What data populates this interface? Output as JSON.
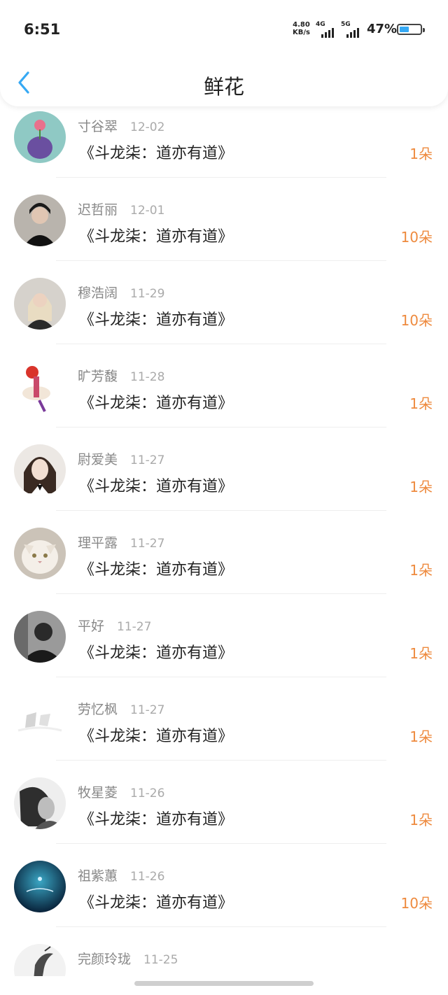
{
  "status": {
    "time": "6:51",
    "net_speed_value": "4.80",
    "net_speed_unit": "KB/s",
    "sig1_label": "4G",
    "sig2_label": "5G",
    "battery_percent": "47%",
    "battery_level": 0.47
  },
  "header": {
    "title": "鲜花",
    "back_icon": "chevron-left-icon"
  },
  "colors": {
    "accent": "#36a9f4",
    "count": "#ee8a3e",
    "name": "#888888",
    "date": "#aaaaaa"
  },
  "rows": [
    {
      "name": "寸谷翠",
      "date": "12-02",
      "book": "《斗龙柒：道亦有道》",
      "count": "1朵"
    },
    {
      "name": "迟哲丽",
      "date": "12-01",
      "book": "《斗龙柒：道亦有道》",
      "count": "10朵"
    },
    {
      "name": "穆浩阔",
      "date": "11-29",
      "book": "《斗龙柒：道亦有道》",
      "count": "10朵"
    },
    {
      "name": "旷芳馥",
      "date": "11-28",
      "book": "《斗龙柒：道亦有道》",
      "count": "1朵"
    },
    {
      "name": "尉爱美",
      "date": "11-27",
      "book": "《斗龙柒：道亦有道》",
      "count": "1朵"
    },
    {
      "name": "理平露",
      "date": "11-27",
      "book": "《斗龙柒：道亦有道》",
      "count": "1朵"
    },
    {
      "name": "平好",
      "date": "11-27",
      "book": "《斗龙柒：道亦有道》",
      "count": "1朵"
    },
    {
      "name": "劳忆枫",
      "date": "11-27",
      "book": "《斗龙柒：道亦有道》",
      "count": "1朵"
    },
    {
      "name": "牧星菱",
      "date": "11-26",
      "book": "《斗龙柒：道亦有道》",
      "count": "1朵"
    },
    {
      "name": "祖紫蕙",
      "date": "11-26",
      "book": "《斗龙柒：道亦有道》",
      "count": "10朵"
    },
    {
      "name": "完颜玲珑",
      "date": "11-25",
      "book": "",
      "count": ""
    }
  ]
}
